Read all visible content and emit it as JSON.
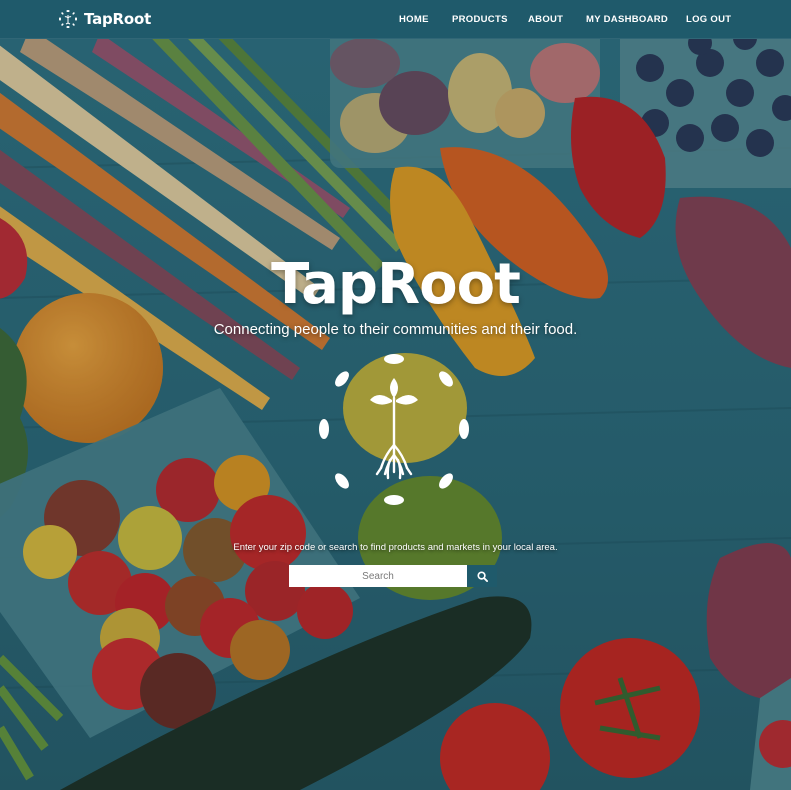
{
  "brand": {
    "name": "TapRoot"
  },
  "nav": {
    "home": "HOME",
    "products": "PRODUCTS",
    "about": "ABOUT",
    "dashboard": "MY DASHBOARD",
    "logout": "LOG OUT"
  },
  "hero": {
    "title": "TapRoot",
    "tagline": "Connecting people to their communities and their food.",
    "instruction": "Enter your zip code or search to find products and markets in your local area."
  },
  "search": {
    "placeholder": "Search",
    "button_icon": "search-icon"
  },
  "colors": {
    "navbar": "#1f5a6b",
    "wood": "#2f7384",
    "text": "#ffffff"
  }
}
